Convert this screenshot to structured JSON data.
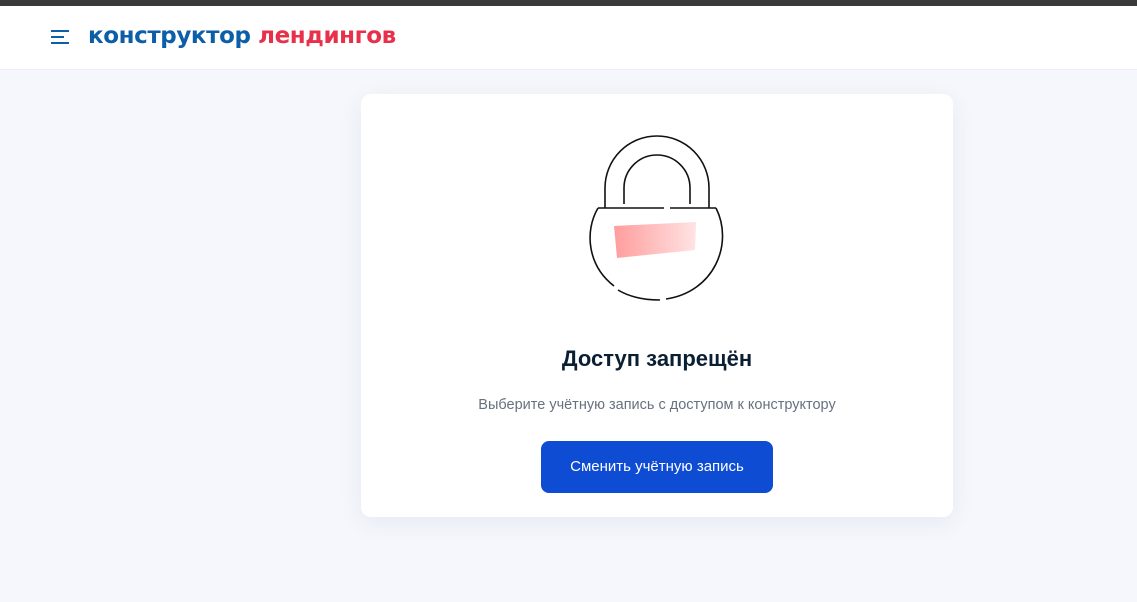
{
  "header": {
    "logo_part1": "конструктор",
    "logo_part2": "лендингов"
  },
  "card": {
    "title": "Доступ запрещён",
    "subtitle": "Выберите учётную запись с доступом к конструктору",
    "button_label": "Сменить учётную запись"
  },
  "icons": {
    "menu": "menu-icon",
    "illustration": "padlock-icon"
  },
  "colors": {
    "brand_blue": "#0d5ea8",
    "brand_red": "#e8304a",
    "button": "#0d4cd3",
    "page_background": "#f5f7fc",
    "title": "#0b1f33",
    "subtitle": "#66727f"
  }
}
